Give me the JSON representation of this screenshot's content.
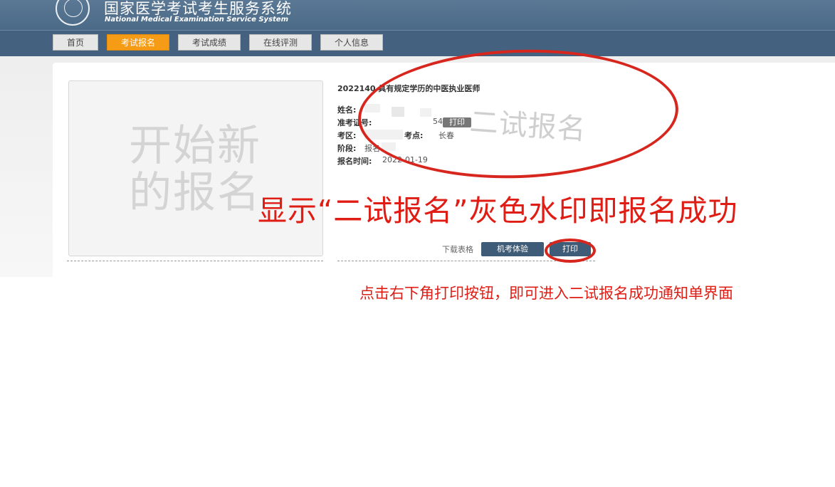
{
  "header": {
    "title": "国家医学考试考生服务系统",
    "subtitle": "National Medical Examination Service System"
  },
  "nav": {
    "tabs": [
      {
        "label": "首页",
        "active": false
      },
      {
        "label": "考试报名",
        "active": true
      },
      {
        "label": "考试成绩",
        "active": false
      },
      {
        "label": "在线评测",
        "active": false
      },
      {
        "label": "个人信息",
        "active": false
      }
    ]
  },
  "new_card": {
    "line1": "开始新",
    "line2": "的报名"
  },
  "exam": {
    "title": "2022140 具有规定学历的中医执业医师",
    "fields": {
      "name_label": "姓名:",
      "admission_label": "准考证号:",
      "admission_value_suffix": "54",
      "area_label": "考区:",
      "site_label": "考点:",
      "site_value": "长春",
      "stage_label": "阶段:",
      "stage_value": "报名",
      "time_label": "报名时间:",
      "time_value": "2022-01-19"
    },
    "print_mini_label": "打印",
    "watermark": "二试报名"
  },
  "actions": {
    "download_label": "下载表格",
    "machine_exam_label": "机考体验",
    "print_label": "打印"
  },
  "annotations": {
    "main": "显示“二试报名”灰色水印即报名成功",
    "hint": "点击右下角打印按钮，即可进入二试报名成功通知单界面",
    "color": "#e01d15"
  },
  "colors": {
    "header": "#4b6a87",
    "nav": "#44627f",
    "active_tab": "#f59b16",
    "button": "#3e5b77"
  }
}
